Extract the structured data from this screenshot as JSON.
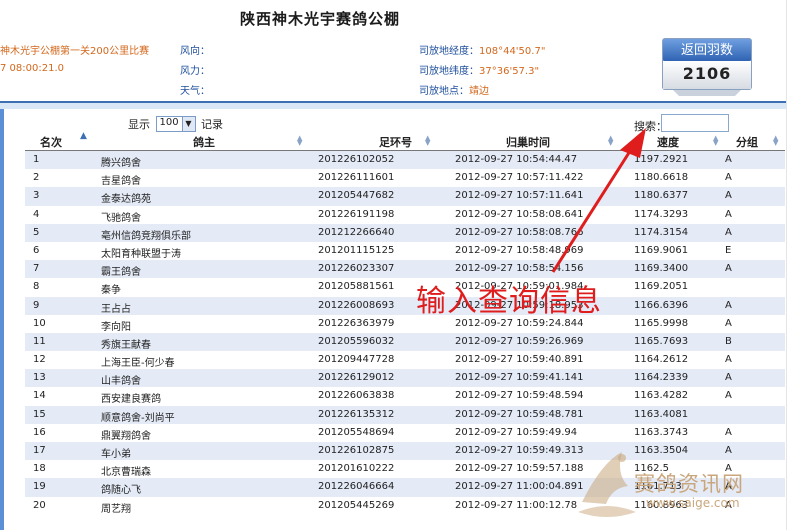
{
  "header": {
    "title": "陕西神木光宇赛鸽公棚",
    "race_name": "神木光宇公棚第一关200公里比赛",
    "race_time": "7 08:00:21.0",
    "wind_direction_label": "风向：",
    "wind_power_label": "风力：",
    "weather_label": "天气：",
    "longitude_label": "司放地经度：",
    "longitude_value": "108°44'50.7\"",
    "latitude_label": "司放地纬度：",
    "latitude_value": "37°36'57.3\"",
    "location_label": "司放地点：",
    "location_value": "靖边",
    "return_count_label": "返回羽数",
    "return_count_value": "2106"
  },
  "controls": {
    "show_label": "显示",
    "page_size": "100",
    "records_label": "记录",
    "search_label": "搜索："
  },
  "table": {
    "columns": [
      "名次",
      "鸽主",
      "足环号",
      "归巢时间",
      "速度",
      "分组"
    ],
    "rows": [
      {
        "rank": "1",
        "owner": "腾兴鸽舍",
        "ring": "201226102052",
        "time": "2012-09-27 10:54:44.47",
        "speed": "1197.2921",
        "group": "A"
      },
      {
        "rank": "2",
        "owner": "吉星鸽舍",
        "ring": "201226111601",
        "time": "2012-09-27 10:57:11.422",
        "speed": "1180.6618",
        "group": "A"
      },
      {
        "rank": "3",
        "owner": "金泰达鸽苑",
        "ring": "201205447682",
        "time": "2012-09-27 10:57:11.641",
        "speed": "1180.6377",
        "group": "A"
      },
      {
        "rank": "4",
        "owner": "飞驰鸽舍",
        "ring": "201226191198",
        "time": "2012-09-27 10:58:08.641",
        "speed": "1174.3293",
        "group": "A"
      },
      {
        "rank": "5",
        "owner": "亳州信鸽竞翔俱乐部",
        "ring": "201212266640",
        "time": "2012-09-27 10:58:08.766",
        "speed": "1174.3154",
        "group": "A"
      },
      {
        "rank": "6",
        "owner": "太阳育种联盟于涛",
        "ring": "201201115125",
        "time": "2012-09-27 10:58:48.969",
        "speed": "1169.9061",
        "group": "E"
      },
      {
        "rank": "7",
        "owner": "霸王鸽舍",
        "ring": "201226023307",
        "time": "2012-09-27 10:58:54.156",
        "speed": "1169.3400",
        "group": "A"
      },
      {
        "rank": "8",
        "owner": "秦争",
        "ring": "201205881561",
        "time": "2012-09-27 10:59:01.984",
        "speed": "1169.2051",
        "group": ""
      },
      {
        "rank": "9",
        "owner": "王占占",
        "ring": "201226008693",
        "time": "2012-09-27 10:59:18.953",
        "speed": "1166.6396",
        "group": "A"
      },
      {
        "rank": "10",
        "owner": "李向阳",
        "ring": "201226363979",
        "time": "2012-09-27 10:59:24.844",
        "speed": "1165.9998",
        "group": "A"
      },
      {
        "rank": "11",
        "owner": "秀旗王献春",
        "ring": "201205596032",
        "time": "2012-09-27 10:59:26.969",
        "speed": "1165.7693",
        "group": "B"
      },
      {
        "rank": "12",
        "owner": "上海王臣-何少春",
        "ring": "201209447728",
        "time": "2012-09-27 10:59:40.891",
        "speed": "1164.2612",
        "group": "A"
      },
      {
        "rank": "13",
        "owner": "山丰鸽舍",
        "ring": "201226129012",
        "time": "2012-09-27 10:59:41.141",
        "speed": "1164.2339",
        "group": "A"
      },
      {
        "rank": "14",
        "owner": "西安建良赛鸽",
        "ring": "201226063838",
        "time": "2012-09-27 10:59:48.594",
        "speed": "1163.4282",
        "group": "A"
      },
      {
        "rank": "15",
        "owner": "顺意鸽舍-刘尚平",
        "ring": "201226135312",
        "time": "2012-09-27 10:59:48.781",
        "speed": "1163.4081",
        "group": ""
      },
      {
        "rank": "16",
        "owner": "鼎翼翔鸽舍",
        "ring": "201205548694",
        "time": "2012-09-27 10:59:49.94",
        "speed": "1163.3743",
        "group": "A"
      },
      {
        "rank": "17",
        "owner": "车小弟",
        "ring": "201226102875",
        "time": "2012-09-27 10:59:49.313",
        "speed": "1163.3504",
        "group": "A"
      },
      {
        "rank": "18",
        "owner": "北京曹瑞森",
        "ring": "201201610222",
        "time": "2012-09-27 10:59:57.188",
        "speed": "1162.5",
        "group": "A"
      },
      {
        "rank": "19",
        "owner": "鸽随心飞",
        "ring": "201226046664",
        "time": "2012-09-27 11:00:04.891",
        "speed": "1161.713",
        "group": "A"
      },
      {
        "rank": "20",
        "owner": "周艺翔",
        "ring": "201205445269",
        "time": "2012-09-27 11:00:12.78",
        "speed": "1160.8963",
        "group": "A"
      }
    ]
  },
  "annotation": {
    "text": "输入查询信息",
    "color": "#e01d1d"
  },
  "watermark": {
    "cn": "赛鸽资讯网",
    "url": "www.saige.com"
  },
  "colors": {
    "accent_blue": "#3d6fb5",
    "row_stripe": "#e4ebf7",
    "orange_text": "#d3681d",
    "annotation_red": "#e01d1d"
  }
}
